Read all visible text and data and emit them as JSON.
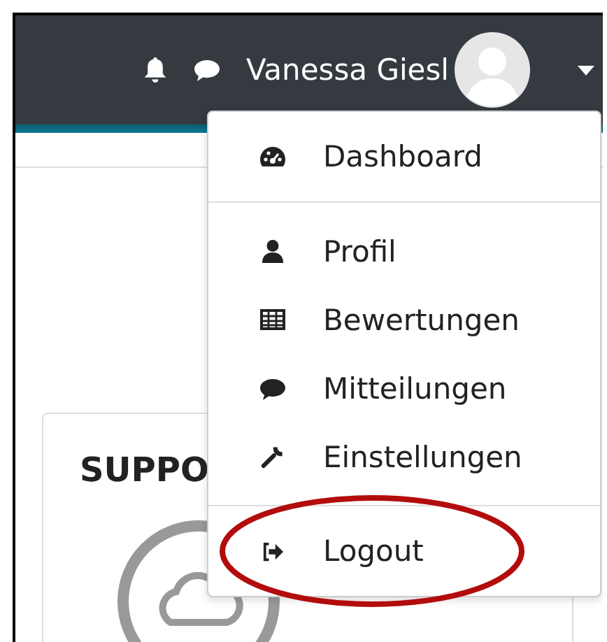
{
  "navbar": {
    "user_name": "Vanessa Giesl"
  },
  "user_menu": {
    "groups": [
      {
        "items": [
          {
            "label": "Dashboard",
            "highlighted": false
          }
        ]
      },
      {
        "items": [
          {
            "label": "Profil",
            "highlighted": false
          },
          {
            "label": "Bewertungen",
            "highlighted": false
          },
          {
            "label": "Mitteilungen",
            "highlighted": false
          },
          {
            "label": "Einstellungen",
            "highlighted": false
          }
        ]
      },
      {
        "items": [
          {
            "label": "Logout",
            "highlighted": true
          }
        ]
      }
    ]
  },
  "card": {
    "title": "SUPPO"
  }
}
